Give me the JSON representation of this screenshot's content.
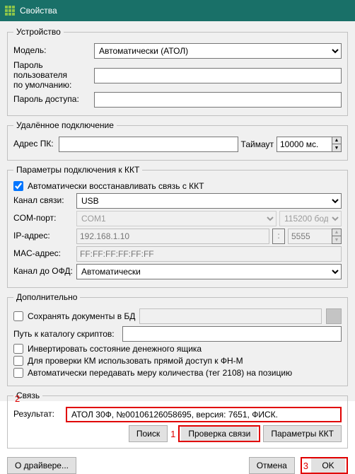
{
  "window": {
    "title": "Свойства"
  },
  "device": {
    "legend": "Устройство",
    "model_label": "Модель:",
    "model_value": "Автоматически (АТОЛ)",
    "user_pwd_label": "Пароль пользователя\nпо умолчанию:",
    "user_pwd_value": "",
    "access_pwd_label": "Пароль доступа:",
    "access_pwd_value": ""
  },
  "remote": {
    "legend": "Удалённое подключение",
    "pc_addr_label": "Адрес ПК:",
    "pc_addr_value": "",
    "timeout_label": "Таймаут",
    "timeout_value": "10000 мс."
  },
  "conn": {
    "legend": "Параметры подключения к ККТ",
    "auto_restore_label": "Автоматически восстанавливать связь с ККТ",
    "auto_restore_checked": true,
    "channel_label": "Канал связи:",
    "channel_value": "USB",
    "com_label": "COM-порт:",
    "com_value": "COM1",
    "com_baud_value": "115200 бод",
    "ip_label": "IP-адрес:",
    "ip_placeholder": "192.168.1.10",
    "ip_port_value": "5555",
    "mac_label": "MAC-адрес:",
    "mac_placeholder": "FF:FF:FF:FF:FF:FF",
    "ofd_label": "Канал до ОФД:",
    "ofd_value": "Автоматически"
  },
  "extra": {
    "legend": "Дополнительно",
    "save_db_label": "Сохранять документы в БД",
    "script_path_label": "Путь к каталогу скриптов:",
    "script_path_value": "",
    "invert_drawer_label": "Инвертировать состояние денежного ящика",
    "direct_km_label": "Для проверки КМ использовать прямой доступ к ФН-М",
    "auto_measure_label": "Автоматически передавать меру количества (тег 2108) на позицию"
  },
  "link": {
    "legend": "Связь",
    "result_label": "Результат:",
    "result_value": "АТОЛ 30Ф, №00106126058695, версия: 7651, ФИСК.",
    "btn_search": "Поиск",
    "btn_check": "Проверка связи",
    "btn_params": "Параметры ККТ"
  },
  "footer": {
    "about": "О драйвере...",
    "cancel": "Отмена",
    "ok": "OK"
  },
  "annotations": {
    "n1": "1",
    "n2": "2",
    "n3": "3"
  }
}
